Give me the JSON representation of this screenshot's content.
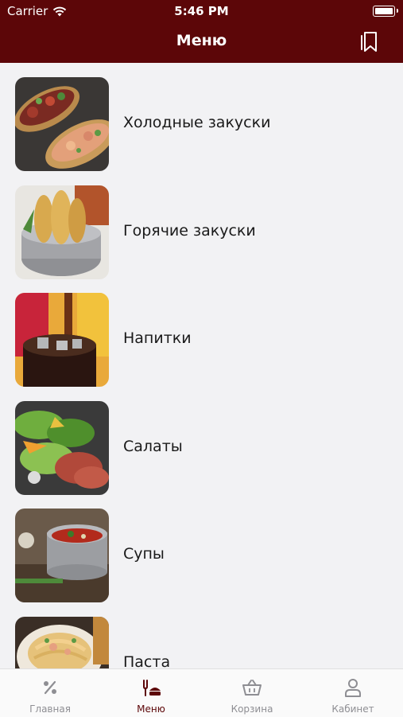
{
  "status_bar": {
    "carrier": "Carrier",
    "time": "5:46 PM"
  },
  "header": {
    "title": "Меню"
  },
  "menu": {
    "items": [
      {
        "label": "Холодные закуски",
        "icon": "cold-appetizers-photo"
      },
      {
        "label": "Горячие закуски",
        "icon": "hot-appetizers-photo"
      },
      {
        "label": "Напитки",
        "icon": "drinks-photo"
      },
      {
        "label": "Салаты",
        "icon": "salads-photo"
      },
      {
        "label": "Супы",
        "icon": "soups-photo"
      },
      {
        "label": "Паста",
        "icon": "pasta-photo"
      }
    ]
  },
  "tabbar": {
    "tabs": [
      {
        "label": "Главная",
        "icon": "percent-icon"
      },
      {
        "label": "Меню",
        "icon": "menu-dish-icon",
        "active": true
      },
      {
        "label": "Корзина",
        "icon": "basket-icon"
      },
      {
        "label": "Кабинет",
        "icon": "person-icon"
      }
    ]
  },
  "colors": {
    "brand": "#5c0608",
    "inactive": "#8e8e93",
    "background": "#f2f2f4"
  }
}
